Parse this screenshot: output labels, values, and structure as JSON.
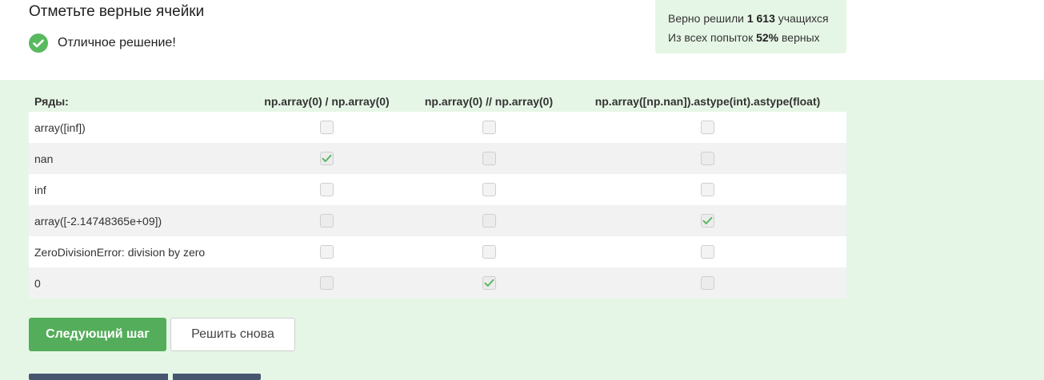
{
  "header": {
    "title": "Отметьте верные ячейки",
    "result_text": "Отличное решение!"
  },
  "stats": {
    "line1_prefix": "Верно решили",
    "line1_count": "1 613",
    "line1_suffix": "учащихся",
    "line2_prefix": "Из всех попыток",
    "line2_percent": "52%",
    "line2_suffix": "верных"
  },
  "table": {
    "header_label": "Ряды:",
    "columns": [
      "np.array(0) / np.array(0)",
      "np.array(0) // np.array(0)",
      "np.array([np.nan]).astype(int).astype(float)"
    ],
    "rows": [
      {
        "label": "array([inf])",
        "checked": [
          false,
          false,
          false
        ]
      },
      {
        "label": "nan",
        "checked": [
          true,
          false,
          false
        ]
      },
      {
        "label": "inf",
        "checked": [
          false,
          false,
          false
        ]
      },
      {
        "label": "array([-2.14748365e+09])",
        "checked": [
          false,
          false,
          true
        ]
      },
      {
        "label": "ZeroDivisionError: division by zero",
        "checked": [
          false,
          false,
          false
        ]
      },
      {
        "label": "0",
        "checked": [
          false,
          true,
          false
        ]
      }
    ]
  },
  "buttons": {
    "next": "Следующий шаг",
    "again": "Решить снова"
  },
  "colors": {
    "accent": "#54ad5a",
    "success": "#59b95f",
    "panel": "#e6f6e6"
  }
}
